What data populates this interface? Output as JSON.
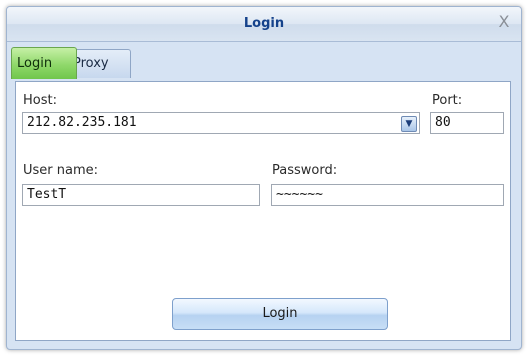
{
  "window": {
    "title": "Login",
    "close_glyph": "X"
  },
  "tabs": [
    {
      "label": "Login",
      "active": true
    },
    {
      "label": "Proxy",
      "active": false
    }
  ],
  "form": {
    "host": {
      "label": "Host:",
      "value": "212.82.235.181",
      "dropdown_icon": "chevron-down-icon"
    },
    "port": {
      "label": "Port:",
      "value": "80"
    },
    "username": {
      "label": "User name:",
      "value": "TestT"
    },
    "password": {
      "label": "Password:",
      "value": "~~~~~~"
    }
  },
  "actions": {
    "login_label": "Login"
  },
  "colors": {
    "title_text": "#15428b",
    "active_tab": "#8fd86a",
    "frame": "#d6e3f3"
  }
}
